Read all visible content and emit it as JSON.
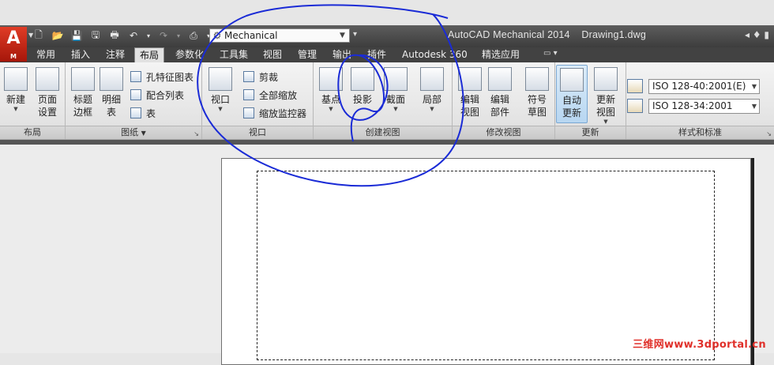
{
  "app": {
    "logo_letter": "A",
    "logo_sub": "M",
    "workspace": "Mechanical",
    "title": "AutoCAD Mechanical 2014    Drawing1.dwg",
    "title_right": "◂ ♦ ▮"
  },
  "tabs": [
    {
      "label": "常用"
    },
    {
      "label": "插入"
    },
    {
      "label": "注释"
    },
    {
      "label": "布局",
      "active": true
    },
    {
      "label": "参数化"
    },
    {
      "label": "工具集"
    },
    {
      "label": "视图"
    },
    {
      "label": "管理"
    },
    {
      "label": "输出"
    },
    {
      "label": "插件"
    },
    {
      "label": "Autodesk 360"
    },
    {
      "label": "精选应用"
    }
  ],
  "panels": {
    "layout": {
      "title": "布局",
      "new": "新建",
      "page_setup": "页面\n设置"
    },
    "sheet": {
      "title": "图纸",
      "title_border": "标题\n边框",
      "bom": "明细\n表",
      "hole_chart": "孔特征图表",
      "fit_list": "配合列表",
      "table": "表"
    },
    "viewport": {
      "title": "视口",
      "viewport": "视口",
      "clip": "剪裁",
      "zoom_all": "全部缩放",
      "scale_monitor": "缩放监控器"
    },
    "create_view": {
      "title": "创建视图",
      "base": "基点",
      "projected": "投影",
      "section": "截面",
      "detail": "局部"
    },
    "modify_view": {
      "title": "修改视图",
      "edit_view": "编辑\n视图",
      "edit_components": "编辑\n部件",
      "symbol_sketch": "符号\n草图"
    },
    "update": {
      "title": "更新",
      "auto_update": "自动\n更新",
      "update_view": "更新\n视图"
    },
    "styles": {
      "title": "样式和标准",
      "standard1": "ISO 128-40:2001(E)",
      "standard2": "ISO 128-34:2001"
    }
  },
  "watermark": "三维网www.3dportal.cn",
  "colors": {
    "title_bar": "#4a4a4a",
    "active_tab": "#e2e2e2",
    "annotation_ink": "#1a2bd6",
    "watermark": "#e0302a"
  }
}
